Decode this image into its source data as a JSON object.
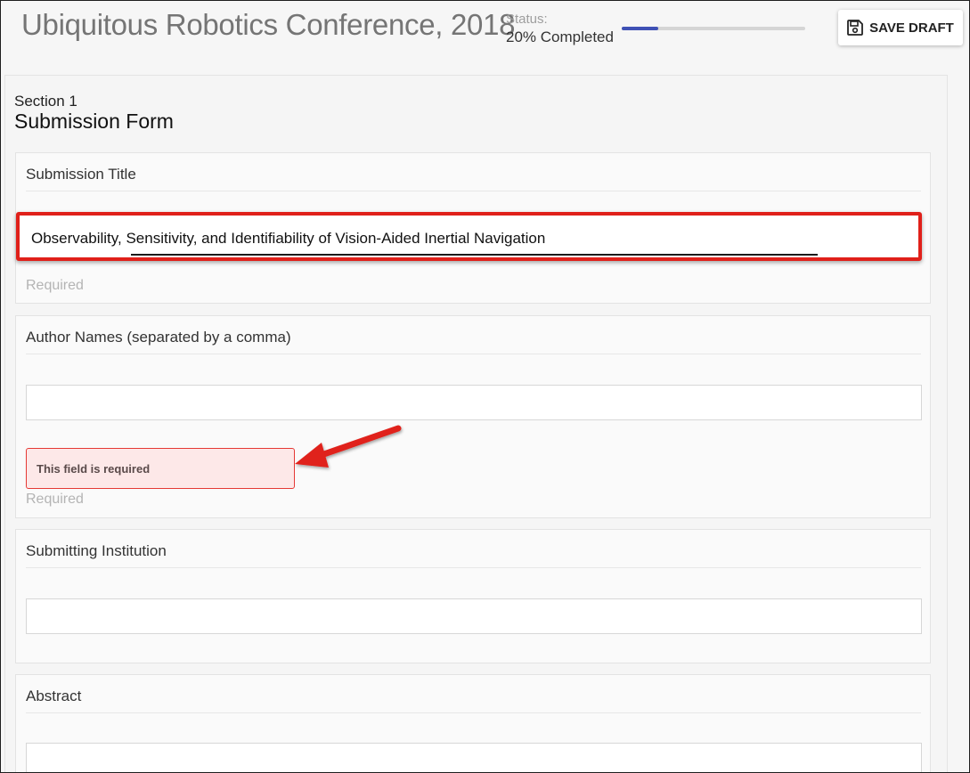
{
  "header": {
    "title": "Ubiquitous Robotics Conference, 2018",
    "status_label": "Status:",
    "status_value": "20% Completed",
    "progress_fraction": 0.2,
    "save_label": "SAVE DRAFT"
  },
  "section": {
    "label": "Section 1",
    "title": "Submission Form"
  },
  "fields": [
    {
      "label": "Submission Title",
      "value": "Observability, Sensitivity, and Identifiability of Vision-Aided Inertial Navigation",
      "helper": "Required"
    },
    {
      "label": "Author Names (separated by a comma)",
      "value": "",
      "error": "This field is required",
      "helper": "Required"
    },
    {
      "label": "Submitting Institution",
      "value": ""
    },
    {
      "label": "Abstract",
      "value": ""
    }
  ],
  "colors": {
    "accent": "#3f51b5",
    "highlight": "#e0201a",
    "error_bg": "#fde8e8",
    "error_border": "#e53935"
  },
  "icons": {
    "save": "floppy-disk-icon",
    "annotation": "red-arrow"
  }
}
